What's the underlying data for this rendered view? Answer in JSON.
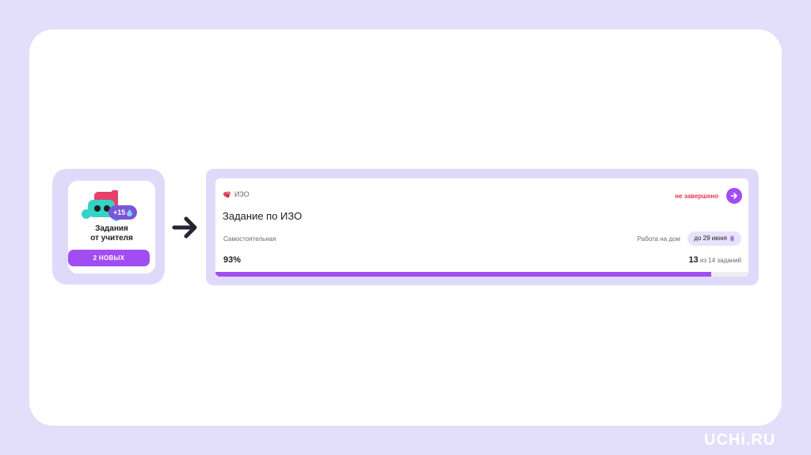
{
  "widget": {
    "coin_badge": "+15",
    "title_line1": "Задания",
    "title_line2": "от учителя",
    "button_label": "2 НОВЫХ"
  },
  "card": {
    "subject": "ИЗО",
    "status": "не завершено",
    "title": "Задание по ИЗО",
    "task_type": "Самостоятельная",
    "work_type": "Работа на дом",
    "deadline": "до 29 июня",
    "percent": "93%",
    "done_count": "13",
    "total_text": "из 14 заданий",
    "progress": 0.93
  },
  "brand": "UCHi.RU",
  "colors": {
    "accent": "#a14df2",
    "status": "#e8344e",
    "frame": "#e0dafa"
  }
}
